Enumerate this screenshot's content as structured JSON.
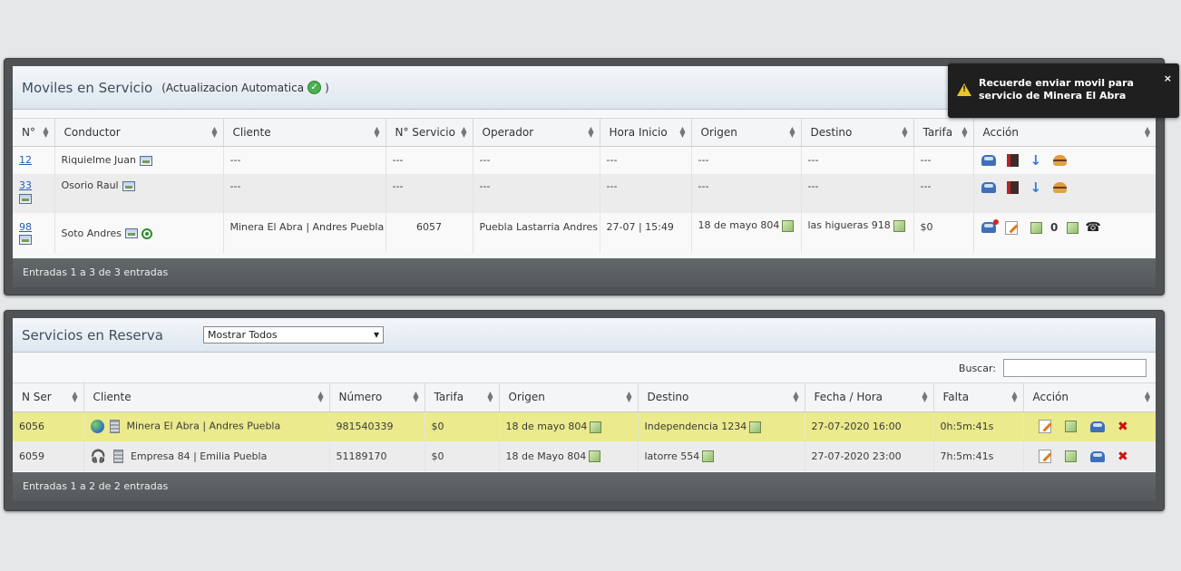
{
  "panel1": {
    "title": "Moviles en Servicio",
    "subtitle": "(Actualizacion Automatica",
    "subtitle_end": ")",
    "columns": [
      "N°",
      "Conductor",
      "Cliente",
      "N° Servicio",
      "Operador",
      "Hora Inicio",
      "Origen",
      "Destino",
      "Tarifa",
      "Acción"
    ],
    "rows": [
      {
        "num": "12",
        "conductor": "Riquielme Juan",
        "cliente": "---",
        "servicio": "---",
        "operador": "---",
        "hora": "---",
        "origen": "---",
        "destino": "---",
        "tarifa": "---"
      },
      {
        "num": "33",
        "conductor": "Osorio Raul",
        "cliente": "---",
        "servicio": "---",
        "operador": "---",
        "hora": "---",
        "origen": "---",
        "destino": "---",
        "tarifa": "---"
      },
      {
        "num": "98",
        "conductor": "Soto Andres",
        "cliente": "Minera El Abra | Andres Puebla",
        "servicio": "6057",
        "operador": "Puebla Lastarria Andres",
        "hora": "27-07 | 15:49",
        "origen": "18 de mayo 804",
        "destino": "las higueras 918",
        "tarifa": "$0",
        "count": "0"
      }
    ],
    "footer": "Entradas 1 a 3 de 3 entradas"
  },
  "panel2": {
    "title": "Servicios en Reserva",
    "filter_value": "Mostrar Todos",
    "search_label": "Buscar:",
    "columns": [
      "N Ser",
      "Cliente",
      "Número",
      "Tarifa",
      "Origen",
      "Destino",
      "Fecha / Hora",
      "Falta",
      "Acción"
    ],
    "rows": [
      {
        "nser": "6056",
        "cliente": "Minera El Abra | Andres Puebla",
        "numero": "981540339",
        "tarifa": "$0",
        "origen": "18 de mayo 804",
        "destino": "Independencia 1234",
        "fecha": "27-07-2020 16:00",
        "falta": "0h:5m:41s"
      },
      {
        "nser": "6059",
        "cliente": "Empresa 84 | Emilia Puebla",
        "numero": "51189170",
        "tarifa": "$0",
        "origen": "18 de Mayo 804",
        "destino": "latorre 554",
        "fecha": "27-07-2020 23:00",
        "falta": "7h:5m:41s"
      }
    ],
    "footer": "Entradas 1 a 2 de 2 entradas"
  },
  "toast": {
    "message": "Recuerde enviar movil para servicio de Minera El Abra",
    "close": "×"
  }
}
